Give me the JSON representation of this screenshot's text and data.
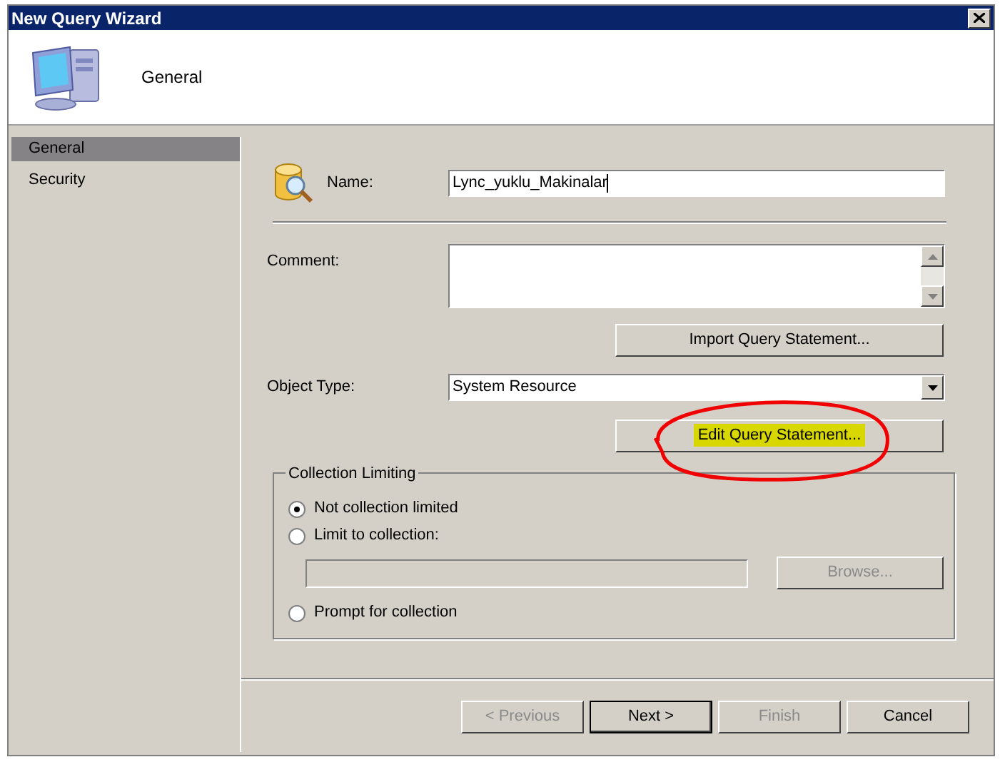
{
  "window": {
    "title": "New Query Wizard"
  },
  "header": {
    "title": "General"
  },
  "sidebar": {
    "items": [
      {
        "label": "General",
        "selected": true
      },
      {
        "label": "Security",
        "selected": false
      }
    ]
  },
  "form": {
    "name_label": "Name:",
    "name_value": "Lync_yuklu_Makinalar",
    "comment_label": "Comment:",
    "import_button": "Import Query Statement...",
    "object_type_label": "Object Type:",
    "object_type_value": "System Resource",
    "edit_button": {
      "label": "Edit Query Statement...",
      "highlighted": true,
      "circled": true
    }
  },
  "collection_limiting": {
    "title": "Collection Limiting",
    "options": [
      {
        "label": "Not collection limited",
        "selected": true
      },
      {
        "label": "Limit to collection:",
        "selected": false
      },
      {
        "label": "Prompt for collection",
        "selected": false
      }
    ],
    "browse_button": {
      "label": "Browse...",
      "disabled": true
    }
  },
  "buttons": [
    {
      "label": "< Previous",
      "disabled": true,
      "default": false
    },
    {
      "label": "Next >",
      "disabled": false,
      "default": true
    },
    {
      "label": "Finish",
      "disabled": true,
      "default": false
    },
    {
      "label": "Cancel",
      "disabled": false,
      "default": false
    }
  ]
}
